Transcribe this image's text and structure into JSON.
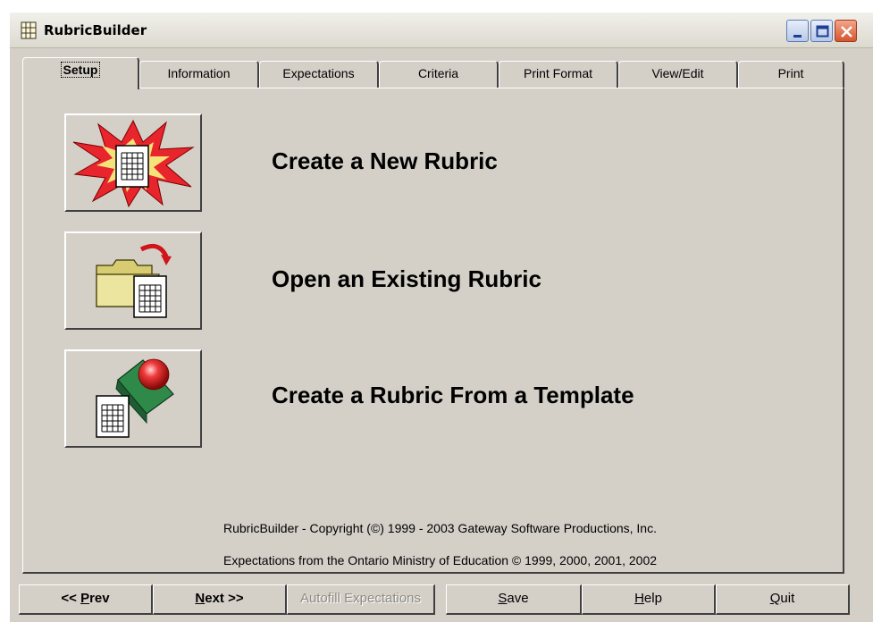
{
  "window": {
    "title": "RubricBuilder"
  },
  "tabs": [
    {
      "label": "Setup",
      "active": true
    },
    {
      "label": "Information",
      "active": false
    },
    {
      "label": "Expectations",
      "active": false
    },
    {
      "label": "Criteria",
      "active": false
    },
    {
      "label": "Print Format",
      "active": false
    },
    {
      "label": "View/Edit",
      "active": false
    },
    {
      "label": "Print",
      "active": false
    }
  ],
  "actions": [
    {
      "label": "Create a New Rubric",
      "icon": "new-rubric-icon"
    },
    {
      "label": "Open an Existing Rubric",
      "icon": "open-folder-icon"
    },
    {
      "label": "Create a Rubric From a Template",
      "icon": "template-stamp-icon"
    }
  ],
  "footer": {
    "copyright": "RubricBuilder - Copyright (©) 1999 - 2003 Gateway Software Productions, Inc.",
    "expectations": "Expectations from the Ontario Ministry of Education © 1999, 2000, 2001, 2002"
  },
  "nav": {
    "prev": {
      "lead": "<< ",
      "mnemonic": "P",
      "rest": "rev"
    },
    "next": {
      "mnemonic": "N",
      "rest": "ext >>"
    },
    "autofill": "Autofill Expectations",
    "save": {
      "mnemonic": "S",
      "rest": "ave"
    },
    "help": {
      "mnemonic": "H",
      "rest": "elp"
    },
    "quit": {
      "mnemonic": "Q",
      "rest": "uit"
    }
  },
  "colors": {
    "face": "#d4d0c8",
    "close_button": "#d4552f",
    "burst_red": "#e8242c",
    "folder_yellow": "#e6de8c",
    "stamp_green": "#2f8a4a"
  }
}
